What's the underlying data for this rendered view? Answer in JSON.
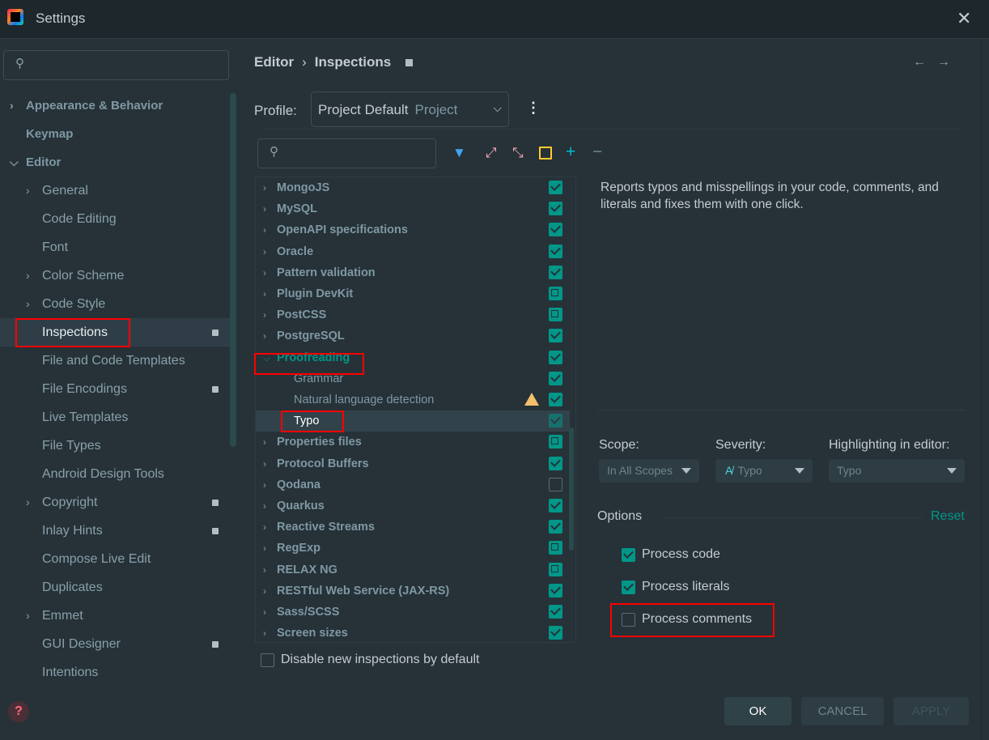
{
  "window": {
    "title": "Settings"
  },
  "sidebar": {
    "search_placeholder": "",
    "items": [
      {
        "label": "Appearance & Behavior",
        "level": 0,
        "bold": true,
        "chevron": "right"
      },
      {
        "label": "Keymap",
        "level": 0,
        "bold": true
      },
      {
        "label": "Editor",
        "level": 0,
        "bold": true,
        "chevron": "down"
      },
      {
        "label": "General",
        "level": 1,
        "chevron": "right"
      },
      {
        "label": "Code Editing",
        "level": 1
      },
      {
        "label": "Font",
        "level": 1
      },
      {
        "label": "Color Scheme",
        "level": 1,
        "chevron": "right"
      },
      {
        "label": "Code Style",
        "level": 1,
        "chevron": "right"
      },
      {
        "label": "Inspections",
        "level": 1,
        "badge": true,
        "selected": true,
        "highlighted": true
      },
      {
        "label": "File and Code Templates",
        "level": 1
      },
      {
        "label": "File Encodings",
        "level": 1,
        "badge": true
      },
      {
        "label": "Live Templates",
        "level": 1
      },
      {
        "label": "File Types",
        "level": 1
      },
      {
        "label": "Android Design Tools",
        "level": 1
      },
      {
        "label": "Copyright",
        "level": 1,
        "chevron": "right",
        "badge": true
      },
      {
        "label": "Inlay Hints",
        "level": 1,
        "badge": true
      },
      {
        "label": "Compose Live Edit",
        "level": 1
      },
      {
        "label": "Duplicates",
        "level": 1
      },
      {
        "label": "Emmet",
        "level": 1,
        "chevron": "right"
      },
      {
        "label": "GUI Designer",
        "level": 1,
        "badge": true
      },
      {
        "label": "Intentions",
        "level": 1
      }
    ]
  },
  "breadcrumb": {
    "parent": "Editor",
    "separator": "›",
    "current": "Inspections"
  },
  "profile": {
    "label": "Profile:",
    "value": "Project Default",
    "scope": "Project"
  },
  "toolbar": {
    "icons": [
      "filter-icon",
      "expand-all-icon",
      "collapse-all-icon",
      "reset-to-empty-icon",
      "add-icon",
      "remove-icon"
    ]
  },
  "tree": [
    {
      "label": "MongoJS",
      "state": "check"
    },
    {
      "label": "MySQL",
      "state": "check"
    },
    {
      "label": "OpenAPI specifications",
      "state": "check"
    },
    {
      "label": "Oracle",
      "state": "check"
    },
    {
      "label": "Pattern validation",
      "state": "check"
    },
    {
      "label": "Plugin DevKit",
      "state": "partial"
    },
    {
      "label": "PostCSS",
      "state": "partial"
    },
    {
      "label": "PostgreSQL",
      "state": "check"
    },
    {
      "label": "Proofreading",
      "state": "check",
      "expanded": true,
      "highlighted": true
    },
    {
      "label": "Grammar",
      "state": "check",
      "child": true
    },
    {
      "label": "Natural language detection",
      "state": "check",
      "child": true,
      "warning": true
    },
    {
      "label": "Typo",
      "state": "check",
      "child": true,
      "selected": true
    },
    {
      "label": "Properties files",
      "state": "partial"
    },
    {
      "label": "Protocol Buffers",
      "state": "check"
    },
    {
      "label": "Qodana",
      "state": "off"
    },
    {
      "label": "Quarkus",
      "state": "check"
    },
    {
      "label": "Reactive Streams",
      "state": "check"
    },
    {
      "label": "RegExp",
      "state": "partial"
    },
    {
      "label": "RELAX NG",
      "state": "partial"
    },
    {
      "label": "RESTful Web Service (JAX-RS)",
      "state": "check"
    },
    {
      "label": "Sass/SCSS",
      "state": "check"
    },
    {
      "label": "Screen sizes",
      "state": "check"
    }
  ],
  "disable_new": {
    "label": "Disable new inspections by default",
    "checked": false
  },
  "description": "Reports typos and misspellings in your code, comments, and literals and fixes them with one click.",
  "scope": {
    "label": "Scope:",
    "value": "In All Scopes"
  },
  "severity": {
    "label": "Severity:",
    "value": "Typo"
  },
  "highlighting": {
    "label": "Highlighting in editor:",
    "value": "Typo"
  },
  "options": {
    "label": "Options",
    "reset": "Reset",
    "items": [
      {
        "label": "Process code",
        "checked": true
      },
      {
        "label": "Process literals",
        "checked": true
      },
      {
        "label": "Process comments",
        "checked": false,
        "highlighted": true
      }
    ]
  },
  "buttons": {
    "ok": "OK",
    "cancel": "CANCEL",
    "apply": "APPLY"
  },
  "colors": {
    "accent": "#009688",
    "background": "#263238",
    "highlight_box": "#ff0000"
  }
}
